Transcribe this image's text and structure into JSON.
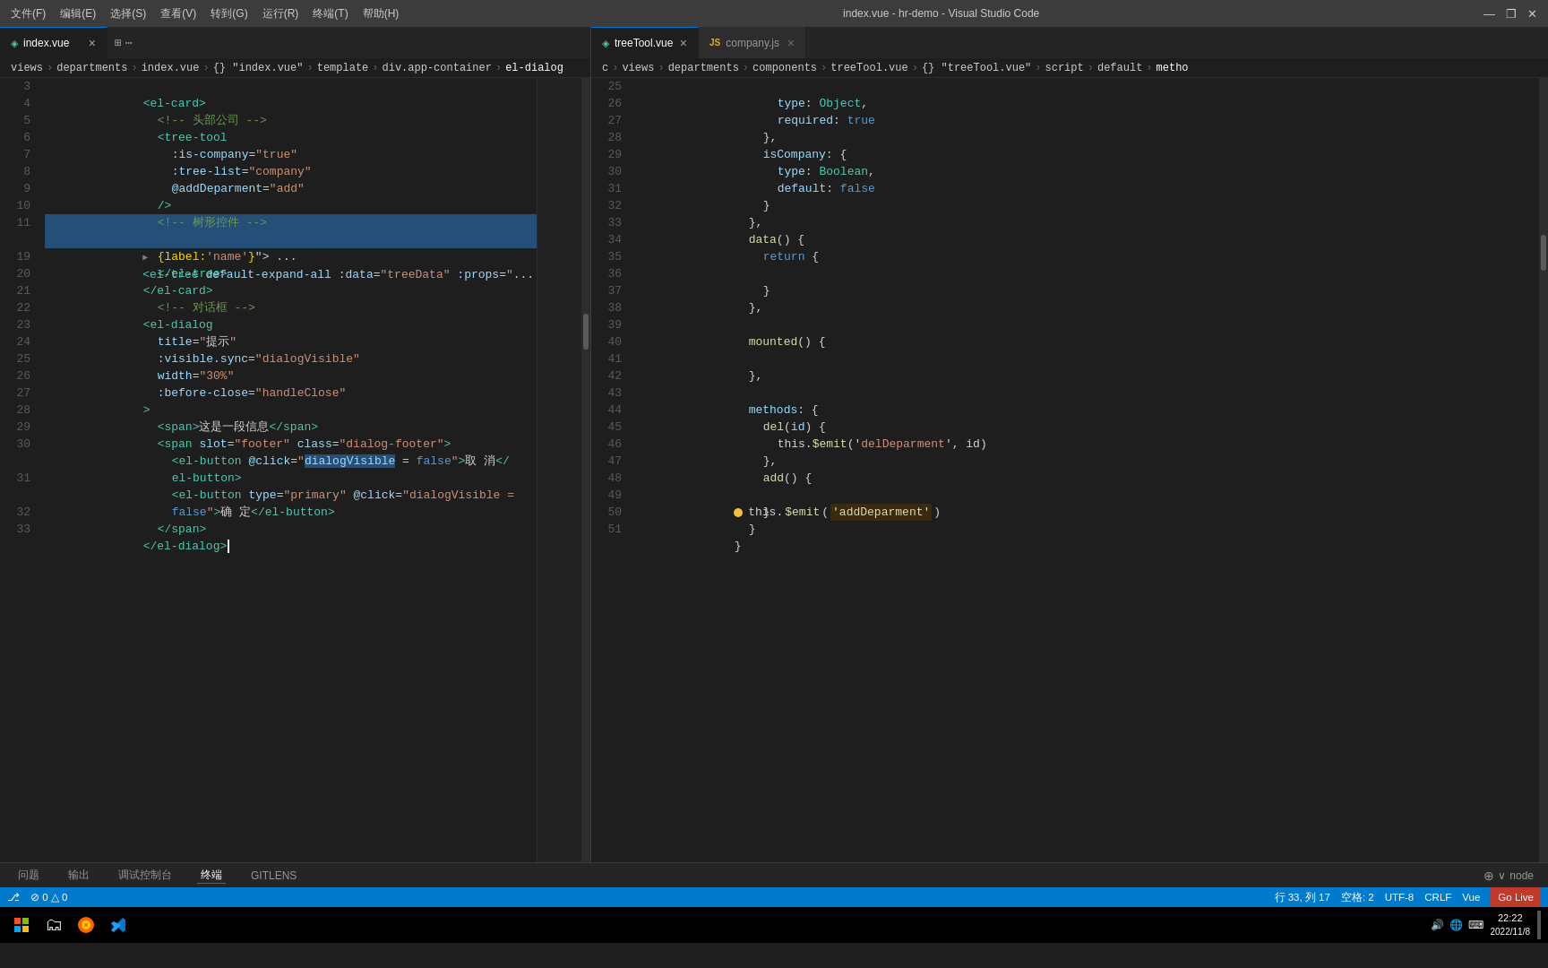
{
  "titlebar": {
    "menu_items": [
      "文件(F)",
      "编辑(E)",
      "选择(S)",
      "查看(V)",
      "转到(G)",
      "运行(R)",
      "终端(T)",
      "帮助(H)"
    ],
    "title": "index.vue - hr-demo - Visual Studio Code",
    "controls": [
      "▢",
      "❐",
      "✕"
    ]
  },
  "tabs_left": {
    "items": [
      {
        "label": "index.vue",
        "icon": "◈",
        "active": true,
        "close": "×"
      }
    ],
    "actions": [
      "⊞",
      "⋯"
    ]
  },
  "tabs_right": {
    "items": [
      {
        "label": "treeTool.vue",
        "icon": "◈",
        "color": "#4ec9b0",
        "active": true,
        "close": "×"
      },
      {
        "label": "company.js",
        "icon": "JS",
        "color": "#dbb233",
        "active": false,
        "close": "×"
      }
    ]
  },
  "breadcrumb_left": {
    "parts": [
      "views",
      ">",
      "departments",
      ">",
      "index.vue",
      ">",
      "{} \"index.vue\"",
      ">",
      "template",
      ">",
      "div.app-container",
      ">",
      "el-dialog"
    ]
  },
  "breadcrumb_right": {
    "parts": [
      "c",
      ">",
      "views",
      ">",
      "departments",
      ">",
      "components",
      ">",
      "treeTool.vue",
      ">",
      "{} \"treeTool.vue\"",
      ">",
      "script",
      ">",
      "default",
      ">",
      "metho"
    ]
  },
  "left_code": {
    "lines": [
      {
        "num": 3,
        "indent": 2,
        "tokens": [
          {
            "t": "<",
            "c": "c-tag"
          },
          {
            "t": "el-card",
            "c": "c-tag"
          },
          {
            "t": ">",
            "c": "c-tag"
          }
        ]
      },
      {
        "num": 4,
        "indent": 3,
        "tokens": [
          {
            "t": "<!-- ",
            "c": "c-cmt"
          },
          {
            "t": "头部公司 ",
            "c": "c-cmt"
          },
          {
            "t": "-->",
            "c": "c-cmt"
          }
        ]
      },
      {
        "num": 5,
        "indent": 3,
        "tokens": [
          {
            "t": "<",
            "c": "c-tag"
          },
          {
            "t": "tree-tool",
            "c": "c-tag"
          }
        ]
      },
      {
        "num": 6,
        "indent": 4,
        "tokens": [
          {
            "t": ":is-company",
            "c": "c-attr"
          },
          {
            "t": "=",
            "c": "c-punct"
          },
          {
            "t": "\"true\"",
            "c": "c-val"
          }
        ]
      },
      {
        "num": 7,
        "indent": 4,
        "tokens": [
          {
            "t": ":tree-list",
            "c": "c-attr"
          },
          {
            "t": "=",
            "c": "c-punct"
          },
          {
            "t": "\"company\"",
            "c": "c-val"
          }
        ]
      },
      {
        "num": 8,
        "indent": 4,
        "tokens": [
          {
            "t": "@addDeparment",
            "c": "c-attr"
          },
          {
            "t": "=",
            "c": "c-punct"
          },
          {
            "t": "\"add\"",
            "c": "c-val"
          }
        ]
      },
      {
        "num": 9,
        "indent": 3,
        "tokens": [
          {
            "t": "/>",
            "c": "c-tag"
          }
        ]
      },
      {
        "num": 10,
        "indent": 3,
        "tokens": [
          {
            "t": "<!-- ",
            "c": "c-cmt"
          },
          {
            "t": "树形控件 ",
            "c": "c-cmt"
          },
          {
            "t": "-->",
            "c": "c-cmt"
          }
        ]
      },
      {
        "num": 11,
        "indent": 3,
        "selected": true,
        "tokens": [
          {
            "t": "<",
            "c": "c-tag"
          },
          {
            "t": "el-tree ",
            "c": "c-tag"
          },
          {
            "t": "default-expand-all ",
            "c": "c-attr"
          },
          {
            "t": ":data",
            "c": "c-attr"
          },
          {
            "t": "=",
            "c": "c-punct"
          },
          {
            "t": "\"treeData\" ",
            "c": "c-val"
          },
          {
            "t": ":props",
            "c": "c-attr"
          },
          {
            "t": "=",
            "c": "c-punct"
          },
          {
            "t": "\"",
            "c": "c-val"
          },
          {
            "t": "...",
            "c": "c-text"
          }
        ]
      },
      {
        "num": "",
        "indent": 3,
        "selected": true,
        "tokens": [
          {
            "t": "{label:",
            "c": "c-bracket"
          },
          {
            "t": "'name'",
            "c": "c-str"
          },
          {
            "t": "}",
            "c": "c-bracket"
          },
          {
            "t": "\"> ...",
            "c": "c-text"
          }
        ]
      },
      {
        "num": 19,
        "indent": 3,
        "tokens": [
          {
            "t": "</",
            "c": "c-tag"
          },
          {
            "t": "el-tree",
            "c": "c-tag"
          },
          {
            "t": ">",
            "c": "c-tag"
          }
        ]
      },
      {
        "num": 20,
        "indent": 2,
        "tokens": [
          {
            "t": "</",
            "c": "c-tag"
          },
          {
            "t": "el-card",
            "c": "c-tag"
          },
          {
            "t": ">",
            "c": "c-tag"
          }
        ]
      },
      {
        "num": 21,
        "indent": 3,
        "tokens": [
          {
            "t": "<!-- ",
            "c": "c-cmt"
          },
          {
            "t": "对话框 ",
            "c": "c-cmt"
          },
          {
            "t": "-->",
            "c": "c-cmt"
          }
        ]
      },
      {
        "num": 22,
        "indent": 2,
        "tokens": [
          {
            "t": "<",
            "c": "c-tag"
          },
          {
            "t": "el-dialog",
            "c": "c-tag"
          }
        ]
      },
      {
        "num": 23,
        "indent": 3,
        "tokens": [
          {
            "t": "title",
            "c": "c-attr"
          },
          {
            "t": "=",
            "c": "c-punct"
          },
          {
            "t": "\"",
            "c": "c-val"
          },
          {
            "t": "提示",
            "c": "c-chinese"
          },
          {
            "t": "\"",
            "c": "c-val"
          }
        ]
      },
      {
        "num": 24,
        "indent": 3,
        "tokens": [
          {
            "t": ":visible.sync",
            "c": "c-attr"
          },
          {
            "t": "=",
            "c": "c-punct"
          },
          {
            "t": "\"dialogVisible\"",
            "c": "c-val"
          }
        ]
      },
      {
        "num": 25,
        "indent": 3,
        "tokens": [
          {
            "t": "width",
            "c": "c-attr"
          },
          {
            "t": "=",
            "c": "c-punct"
          },
          {
            "t": "\"30%\"",
            "c": "c-val"
          }
        ]
      },
      {
        "num": 26,
        "indent": 3,
        "tokens": [
          {
            "t": ":before-close",
            "c": "c-attr"
          },
          {
            "t": "=",
            "c": "c-punct"
          },
          {
            "t": "\"handleClose\"",
            "c": "c-val"
          }
        ]
      },
      {
        "num": 27,
        "indent": 2,
        "tokens": [
          {
            "t": ">",
            "c": "c-tag"
          }
        ]
      },
      {
        "num": 28,
        "indent": 3,
        "tokens": [
          {
            "t": "<span>",
            "c": "c-tag"
          },
          {
            "t": "这是一段信息",
            "c": "c-chinese"
          },
          {
            "t": "</span>",
            "c": "c-tag"
          }
        ]
      },
      {
        "num": 29,
        "indent": 3,
        "tokens": [
          {
            "t": "<span ",
            "c": "c-tag"
          },
          {
            "t": "slot",
            "c": "c-attr"
          },
          {
            "t": "=",
            "c": "c-punct"
          },
          {
            "t": "\"footer\" ",
            "c": "c-val"
          },
          {
            "t": "class",
            "c": "c-attr"
          },
          {
            "t": "=",
            "c": "c-punct"
          },
          {
            "t": "\"dialog-footer\"",
            "c": "c-val"
          },
          {
            "t": ">",
            "c": "c-tag"
          }
        ]
      },
      {
        "num": 30,
        "indent": 4,
        "tokens": [
          {
            "t": "<el-button ",
            "c": "c-tag"
          },
          {
            "t": "@click",
            "c": "c-attr"
          },
          {
            "t": "=",
            "c": "c-punct"
          },
          {
            "t": "\"dialogVisible",
            "c": "c-val"
          },
          {
            "t": " = ",
            "c": "c-text"
          },
          {
            "t": "false",
            "c": "c-bool"
          },
          {
            "t": "\"",
            "c": "c-val"
          },
          {
            "t": ">",
            "c": "c-tag"
          },
          {
            "t": "取 消",
            "c": "c-chinese"
          },
          {
            "t": "</",
            "c": "c-tag"
          },
          {
            "t": "",
            "c": ""
          },
          {
            "t": "",
            "c": ""
          }
        ]
      },
      {
        "num": "",
        "indent": 4,
        "tokens": [
          {
            "t": "el-button>",
            "c": "c-tag"
          }
        ]
      },
      {
        "num": 31,
        "indent": 4,
        "tokens": [
          {
            "t": "<el-button ",
            "c": "c-tag"
          },
          {
            "t": "type",
            "c": "c-attr"
          },
          {
            "t": "=",
            "c": "c-punct"
          },
          {
            "t": "\"primary\" ",
            "c": "c-val"
          },
          {
            "t": "@click",
            "c": "c-attr"
          },
          {
            "t": "=",
            "c": "c-punct"
          },
          {
            "t": "\"dialogVisible =",
            "c": "c-val"
          }
        ]
      },
      {
        "num": "",
        "indent": 4,
        "tokens": [
          {
            "t": "false",
            "c": "c-bool"
          },
          {
            "t": "\"",
            "c": "c-val"
          },
          {
            "t": ">",
            "c": "c-tag"
          },
          {
            "t": "确 定",
            "c": "c-chinese"
          },
          {
            "t": "</el-button>",
            "c": "c-tag"
          }
        ]
      },
      {
        "num": 32,
        "indent": 3,
        "tokens": [
          {
            "t": "</span>",
            "c": "c-tag"
          }
        ]
      },
      {
        "num": 33,
        "indent": 2,
        "tokens": [
          {
            "t": "</",
            "c": "c-tag"
          },
          {
            "t": "el-dialog",
            "c": "c-tag"
          },
          {
            "t": ">",
            "c": "c-tag"
          },
          {
            "t": "|",
            "c": "c-text"
          }
        ]
      }
    ]
  },
  "right_code": {
    "lines": [
      {
        "num": 25,
        "indent": 4,
        "tokens": [
          {
            "t": "type: ",
            "c": "c-type"
          },
          {
            "t": "Object",
            "c": "c-type"
          },
          {
            "t": ",",
            "c": "c-punct"
          }
        ]
      },
      {
        "num": 26,
        "indent": 4,
        "tokens": [
          {
            "t": "required: ",
            "c": "c-kw"
          },
          {
            "t": "true",
            "c": "c-bool"
          }
        ]
      },
      {
        "num": 27,
        "indent": 3,
        "tokens": [
          {
            "t": "},",
            "c": "c-punct"
          }
        ]
      },
      {
        "num": 28,
        "indent": 3,
        "tokens": [
          {
            "t": "isCompany",
            "c": "c-prop"
          },
          {
            "t": ": {",
            "c": "c-punct"
          }
        ]
      },
      {
        "num": 29,
        "indent": 4,
        "tokens": [
          {
            "t": "type",
            "c": "c-prop"
          },
          {
            "t": ": ",
            "c": "c-punct"
          },
          {
            "t": "Boolean",
            "c": "c-type"
          },
          {
            "t": ",",
            "c": "c-punct"
          }
        ]
      },
      {
        "num": 30,
        "indent": 4,
        "tokens": [
          {
            "t": "default",
            "c": "c-prop"
          },
          {
            "t": ": ",
            "c": "c-punct"
          },
          {
            "t": "false",
            "c": "c-bool"
          }
        ]
      },
      {
        "num": 31,
        "indent": 3,
        "tokens": [
          {
            "t": "}",
            "c": "c-punct"
          }
        ]
      },
      {
        "num": 32,
        "indent": 2,
        "tokens": [
          {
            "t": "},",
            "c": "c-punct"
          }
        ]
      },
      {
        "num": 33,
        "indent": 2,
        "tokens": [
          {
            "t": "data",
            "c": "c-fn"
          },
          {
            "t": "() {",
            "c": "c-punct"
          }
        ]
      },
      {
        "num": 34,
        "indent": 3,
        "tokens": [
          {
            "t": "return {",
            "c": "c-kw"
          }
        ]
      },
      {
        "num": 35,
        "indent": 0,
        "tokens": []
      },
      {
        "num": 36,
        "indent": 3,
        "tokens": [
          {
            "t": "}",
            "c": "c-punct"
          }
        ]
      },
      {
        "num": 37,
        "indent": 2,
        "tokens": [
          {
            "t": "},",
            "c": "c-punct"
          }
        ]
      },
      {
        "num": 38,
        "indent": 0,
        "tokens": []
      },
      {
        "num": 39,
        "indent": 2,
        "tokens": [
          {
            "t": "mounted",
            "c": "c-fn"
          },
          {
            "t": "() {",
            "c": "c-punct"
          }
        ]
      },
      {
        "num": 40,
        "indent": 0,
        "tokens": []
      },
      {
        "num": 41,
        "indent": 2,
        "tokens": [
          {
            "t": "},",
            "c": "c-punct"
          }
        ]
      },
      {
        "num": 42,
        "indent": 0,
        "tokens": []
      },
      {
        "num": 43,
        "indent": 2,
        "tokens": [
          {
            "t": "methods",
            "c": "c-prop"
          },
          {
            "t": ": {",
            "c": "c-punct"
          }
        ]
      },
      {
        "num": 44,
        "indent": 3,
        "tokens": [
          {
            "t": "del",
            "c": "c-fn"
          },
          {
            "t": "(",
            "c": "c-punct"
          },
          {
            "t": "id",
            "c": "c-prop"
          },
          {
            "t": ") {",
            "c": "c-punct"
          }
        ]
      },
      {
        "num": 45,
        "indent": 4,
        "tokens": [
          {
            "t": "this.",
            "c": "c-text"
          },
          {
            "t": "$emit",
            "c": "c-fn"
          },
          {
            "t": "('",
            "c": "c-punct"
          },
          {
            "t": "delDeparment",
            "c": "c-str"
          },
          {
            "t": "', id)",
            "c": "c-punct"
          }
        ]
      },
      {
        "num": 46,
        "indent": 3,
        "tokens": [
          {
            "t": "},",
            "c": "c-punct"
          }
        ]
      },
      {
        "num": 47,
        "indent": 3,
        "tokens": [
          {
            "t": "add",
            "c": "c-fn"
          },
          {
            "t": "() {",
            "c": "c-punct"
          }
        ]
      },
      {
        "num": 48,
        "indent": 4,
        "tokens": [
          {
            "t": "this.",
            "c": "c-text"
          },
          {
            "t": "$emit",
            "c": "c-fn"
          },
          {
            "t": "(",
            "c": "c-punct"
          },
          {
            "t": "'addDeparment'",
            "c": "c-str"
          },
          {
            "t": ")",
            "c": "c-punct"
          },
          {
            "t": "YELLOW_DOT",
            "c": "YELLOW_DOT"
          }
        ]
      },
      {
        "num": 49,
        "indent": 3,
        "tokens": [
          {
            "t": "}",
            "c": "c-punct"
          }
        ]
      },
      {
        "num": 50,
        "indent": 2,
        "tokens": [
          {
            "t": "}",
            "c": "c-punct"
          }
        ]
      },
      {
        "num": 51,
        "indent": 1,
        "tokens": [
          {
            "t": "}",
            "c": "c-punct"
          }
        ]
      }
    ]
  },
  "bottom_panel": {
    "tabs": [
      "问题",
      "输出",
      "调试控制台",
      "终端",
      "GITLENS"
    ],
    "active_tab": "终端",
    "right_text": "node"
  },
  "statusbar": {
    "left_items": [
      "⎇",
      "0△0",
      "⊘0△0"
    ],
    "right_items": [
      "行 33, 列 17",
      "空格: 2",
      "UTF-8",
      "CRLF",
      "Vue",
      "Go Live"
    ]
  },
  "taskbar": {
    "icons": [
      {
        "name": "windows",
        "symbol": "⊞"
      },
      {
        "name": "explorer",
        "symbol": "🗂"
      },
      {
        "name": "browser",
        "symbol": "🌐"
      },
      {
        "name": "vscode",
        "symbol": "💠"
      }
    ],
    "clock": "22:22",
    "date": "2022/11/8"
  }
}
